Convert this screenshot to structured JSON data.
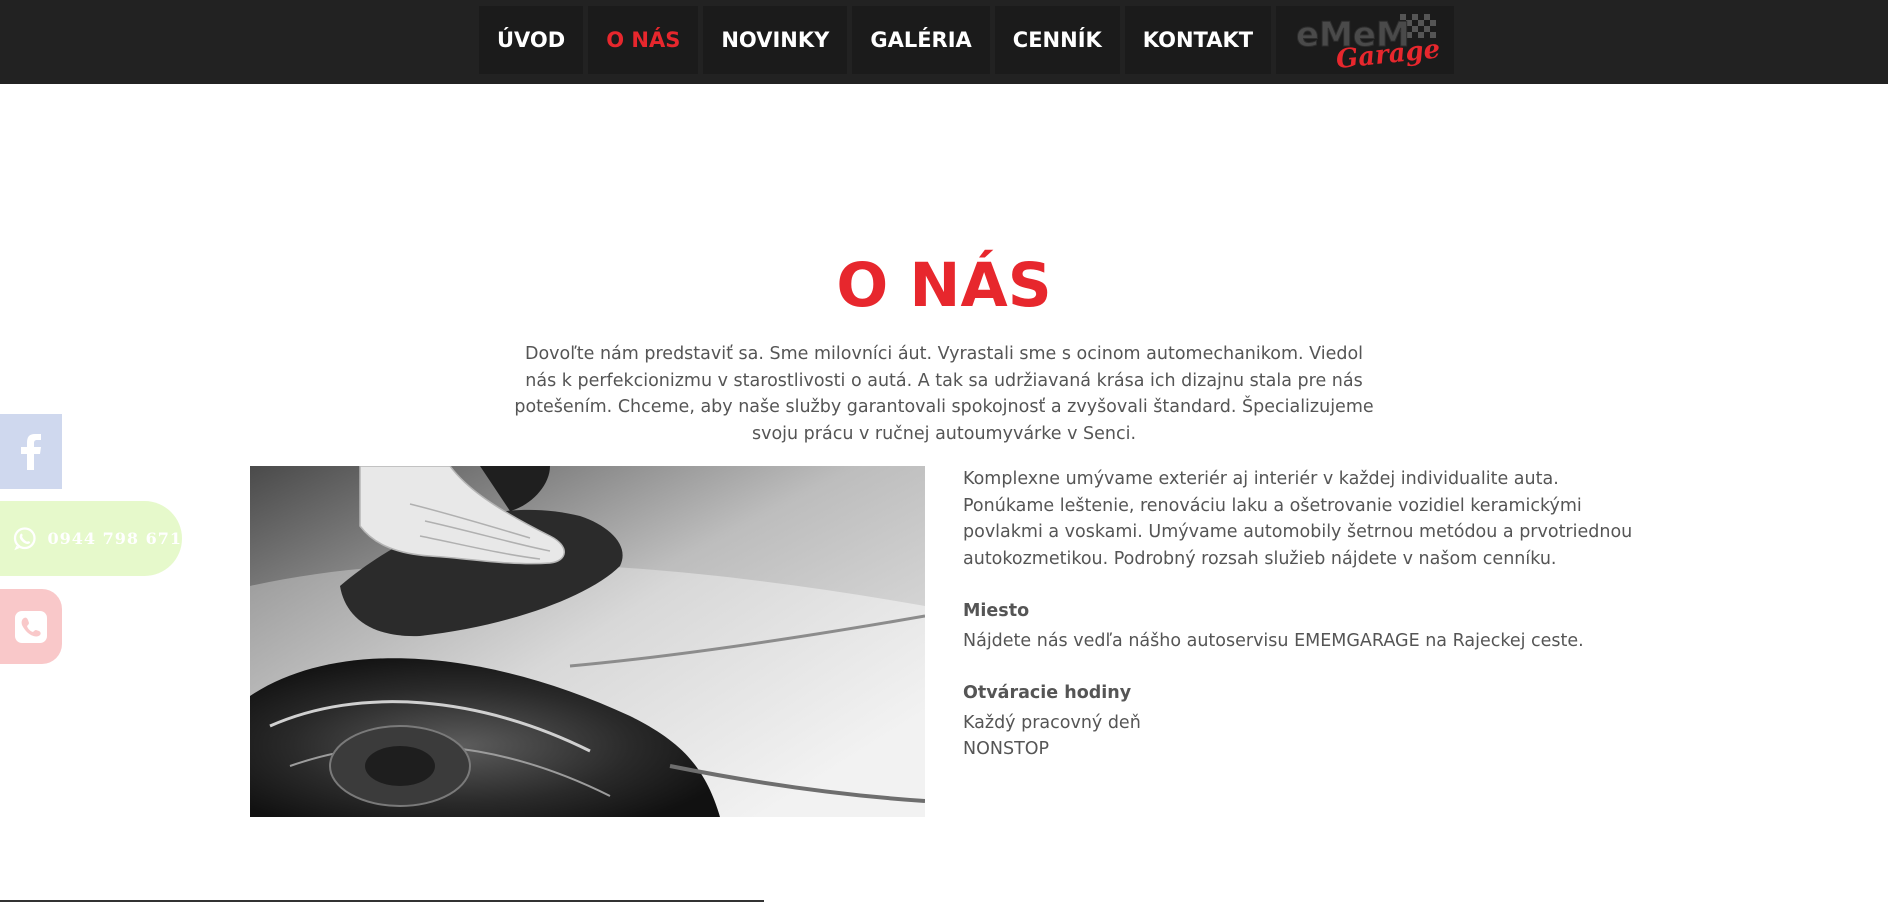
{
  "nav": {
    "items": [
      {
        "label": "ÚVOD",
        "active": false
      },
      {
        "label": "O NÁS",
        "active": true
      },
      {
        "label": "NOVINKY",
        "active": false
      },
      {
        "label": "GALÉRIA",
        "active": false
      },
      {
        "label": "CENNÍK",
        "active": false
      },
      {
        "label": "KONTAKT",
        "active": false
      }
    ],
    "logo": {
      "line1": "eMeM",
      "line2": "Garage"
    }
  },
  "main": {
    "title": "O NÁS",
    "intro": "Dovoľte nám predstaviť sa. Sme milovníci áut. Vyrastali sme s ocinom automechanikom. Viedol nás k perfekcionizmu v starostlivosti o autá. A tak sa udržiavaná krása ich dizajnu stala pre nás potešením. Chceme, aby naše služby garantovali spokojnosť a zvyšovali štandard. Špecializujeme svoju prácu v ručnej autoumyvárke v Senci.",
    "services": "Komplexne umývame exteriér aj interiér v každej individualite auta. Ponúkame leštenie, renováciu laku a ošetrovanie vozidiel keramickými povlakmi a voskami. Umývame automobily šetrnou metódou a prvotriednou autokozmetikou. Podrobný rozsah služieb nájdete v našom cenníku.",
    "location_heading": "Miesto",
    "location_text": "Nájdete nás vedľa nášho autoservisu EMEMGARAGE na Rajeckej ceste.",
    "hours_heading": "Otváracie hodiny",
    "hours_days": "Každý pracovný deň",
    "hours_time": "NONSTOP"
  },
  "floating": {
    "facebook_icon": "facebook-icon",
    "whatsapp_icon": "whatsapp-icon",
    "whatsapp_number": "0944 798 671",
    "phone_icon": "phone-icon"
  },
  "colors": {
    "accent": "#e7272d",
    "topbar": "#222222",
    "nav_item_bg": "#1b1b1b",
    "text": "#555555",
    "facebook_bg": "#cfd8ee",
    "whatsapp_bg": "#e6f9cb",
    "phone_bg": "#f9c8c9"
  }
}
